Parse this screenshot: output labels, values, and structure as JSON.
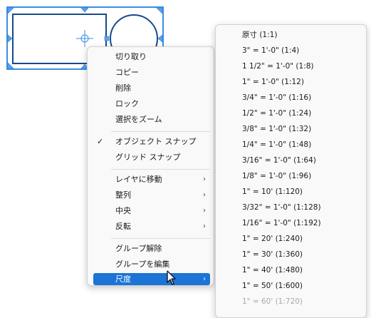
{
  "colors": {
    "selection_blue": "#1b74d6",
    "shape_stroke": "#174a8b",
    "handle": "#3a8ee6"
  },
  "context_menu": {
    "items": [
      {
        "label": "切り取り"
      },
      {
        "label": "コピー"
      },
      {
        "label": "削除"
      },
      {
        "label": "ロック"
      },
      {
        "label": "選択をズーム"
      },
      {
        "label": "オブジェクト スナップ",
        "checked": true,
        "check_icon": "✓"
      },
      {
        "label": "グリッド スナップ"
      },
      {
        "label": "レイヤに移動",
        "submenu": true,
        "arrow": "›"
      },
      {
        "label": "整列",
        "submenu": true,
        "arrow": "›"
      },
      {
        "label": "中央",
        "submenu": true,
        "arrow": "›"
      },
      {
        "label": "反転",
        "submenu": true,
        "arrow": "›"
      },
      {
        "label": "グループ解除"
      },
      {
        "label": "グループを編集"
      },
      {
        "label": "尺度",
        "submenu": true,
        "arrow": "›",
        "highlighted": true
      }
    ]
  },
  "scale_submenu": {
    "items": [
      "原寸 (1:1)",
      "3\" = 1'-0\" (1:4)",
      "1 1/2\" = 1'-0\" (1:8)",
      "1\" = 1'-0\" (1:12)",
      "3/4\" = 1'-0\" (1:16)",
      "1/2\" = 1'-0\" (1:24)",
      "3/8\" = 1'-0\" (1:32)",
      "1/4\" = 1'-0\" (1:48)",
      "3/16\" = 1'-0\" (1:64)",
      "1/8\" = 1'-0\" (1:96)",
      "1\" = 10' (1:120)",
      "3/32\" = 1'-0\" (1:128)",
      "1/16\" = 1'-0\" (1:192)",
      "1\" = 20' (1:240)",
      "1\" = 30' (1:360)",
      "1\" = 40' (1:480)",
      "1\" = 50' (1:600)",
      "1\" = 60' (1:720)"
    ]
  }
}
